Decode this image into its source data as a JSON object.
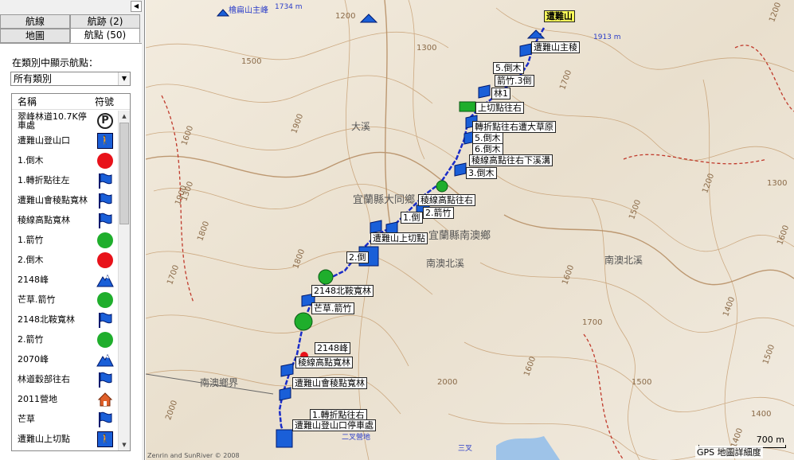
{
  "tabs": {
    "routes": "航線",
    "tracks": "航跡 (2)",
    "map": "地圖",
    "waypoints": "航點 (50)"
  },
  "filter": {
    "label": "在類別中顯示航點：",
    "selected": "所有類別"
  },
  "list": {
    "col_name": "名稱",
    "col_symbol": "符號",
    "rows": [
      {
        "name": "翠峰林道10.7K停車處",
        "icon": "parking-icon"
      },
      {
        "name": "遭難山登山口",
        "icon": "trailhead-hiker-icon"
      },
      {
        "name": "1.倒木",
        "icon": "red-circle-icon"
      },
      {
        "name": "1.轉折點往左",
        "icon": "blue-flag-icon"
      },
      {
        "name": "遭難山會稜點寬林",
        "icon": "blue-flag-icon"
      },
      {
        "name": "稜線高點寬林",
        "icon": "blue-flag-icon"
      },
      {
        "name": "1.箭竹",
        "icon": "green-circle-icon"
      },
      {
        "name": "2.倒木",
        "icon": "red-circle-icon"
      },
      {
        "name": "2148峰",
        "icon": "summit-icon"
      },
      {
        "name": "芒草.箭竹",
        "icon": "green-circle-icon"
      },
      {
        "name": "2148北鞍寬林",
        "icon": "blue-flag-icon"
      },
      {
        "name": "2.箭竹",
        "icon": "green-circle-icon"
      },
      {
        "name": "2070峰",
        "icon": "summit-icon"
      },
      {
        "name": "林道穀部往右",
        "icon": "blue-flag-icon"
      },
      {
        "name": "2011營地",
        "icon": "campsite-house-icon"
      },
      {
        "name": "芒草",
        "icon": "blue-flag-icon"
      },
      {
        "name": "遭難山上切點",
        "icon": "trailhead-hiker-icon"
      }
    ]
  },
  "map": {
    "labels": {
      "peak": "遭難山",
      "peak_elev": "1913 m",
      "top_peak": "檜扁山主峰",
      "top_peak_elev": "1734 m",
      "wp_a": "遭難山主稜",
      "wp_b": "5.倒木",
      "wp_c": "箭竹.3倒",
      "wp_d": "林1",
      "wp_e": "上切點往右",
      "wp_f": "轉折點往右遭大草原",
      "wp_g": "5.倒木",
      "wp_h": "6.倒木",
      "wp_i": "稜線高點往右下溪溝",
      "wp_j": "3.倒木",
      "wp_k": "稜線高點往右",
      "wp_l": "2.箭竹",
      "wp_m": "1.倒",
      "wp_n": "遭難山上切點",
      "wp_o": "2.倒",
      "wp_p": "2148北鞍寬林",
      "wp_q": "芒草.箭竹",
      "wp_r": "2148峰",
      "wp_s": "稜線高點寬林",
      "wp_t": "遭難山會稜點寬林",
      "wp_u": "1.轉折點往右",
      "wp_v": "遭難山登山口停車處",
      "wp_w": "二叉營地"
    },
    "region_labels": {
      "county_a": "宜蘭縣大同鄉",
      "county_b": "宜蘭縣南澳鄉",
      "stream_a": "大溪",
      "stream_b": "南澳北溪",
      "stream_c": "南澳北溪",
      "boundary": "南澳鄉界",
      "small_pt": "三叉"
    },
    "contours": [
      "1300",
      "1500",
      "1700",
      "1200",
      "1600",
      "1900",
      "1800",
      "1200",
      "1700",
      "1600",
      "1500",
      "2000",
      "1600",
      "1500",
      "1400",
      "1400",
      "1300",
      "1200",
      "1900",
      "1700",
      "1800",
      "2000",
      "1400",
      "1500",
      "1600",
      "1300"
    ],
    "copyright": "Zenrin and SunRiver © 2008",
    "scale": {
      "distance": "700 m",
      "detail": "GPS 地圖詳細度"
    }
  }
}
